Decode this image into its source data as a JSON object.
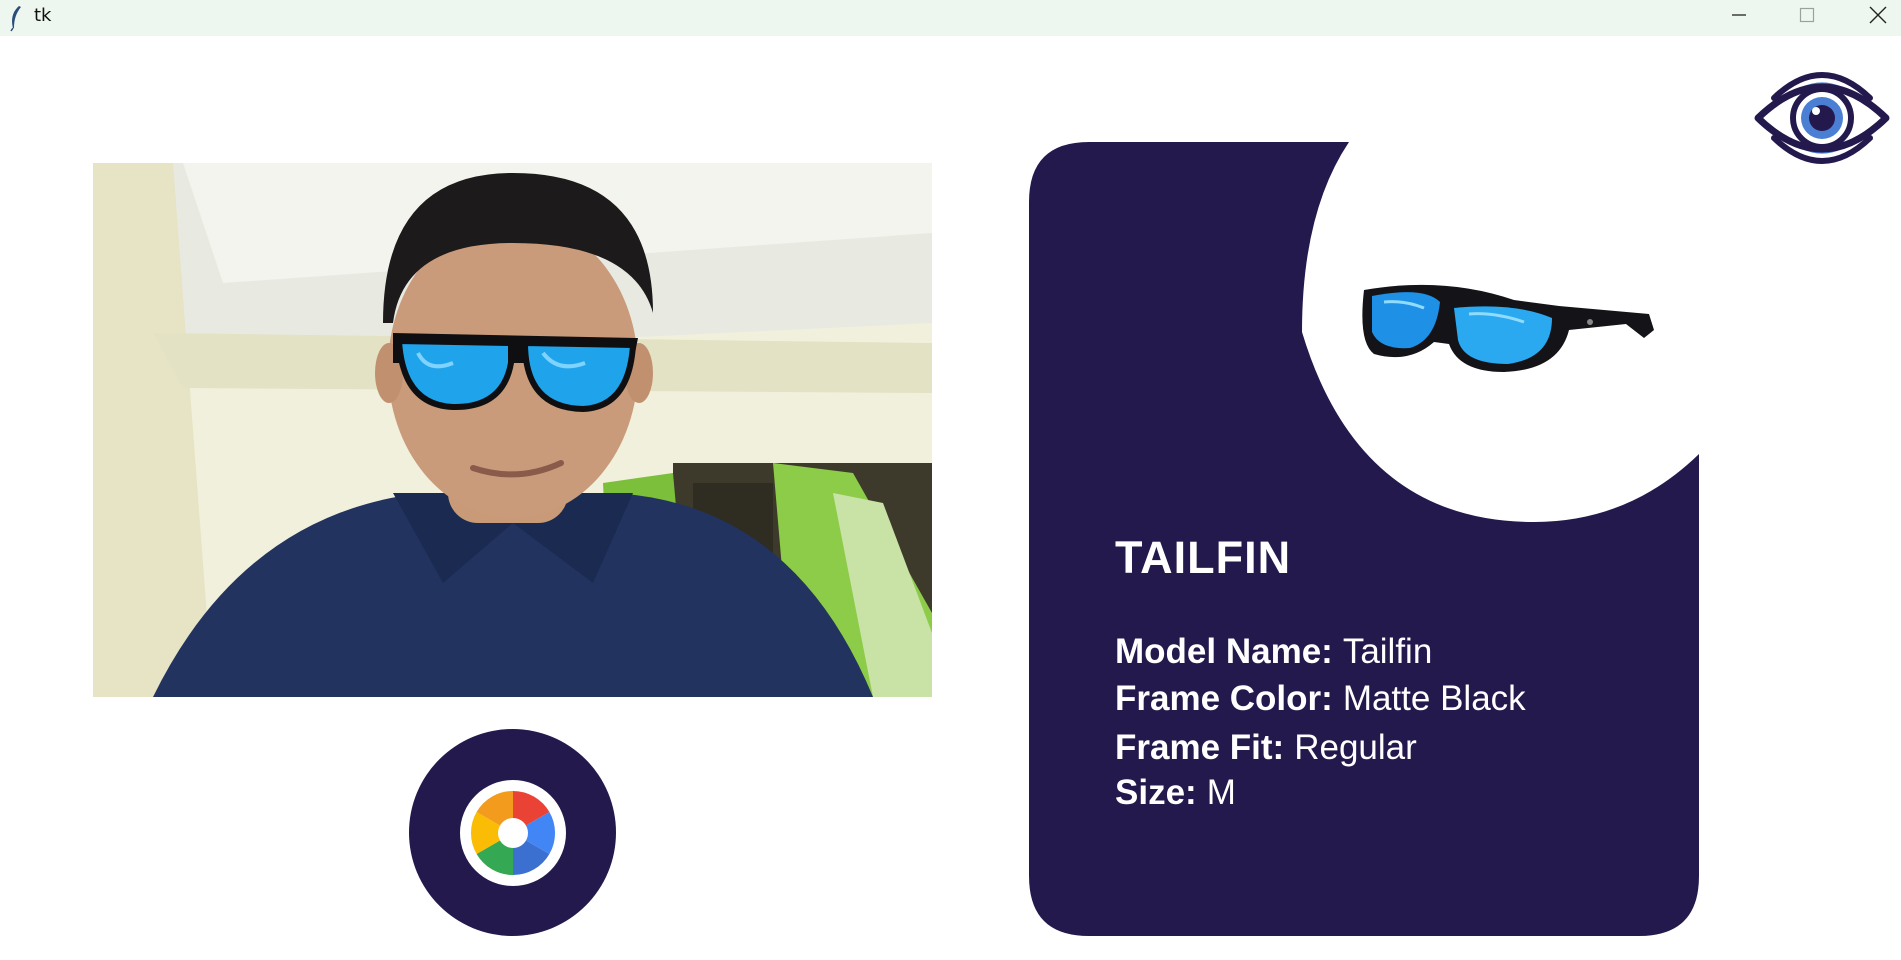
{
  "window": {
    "title": "tk",
    "icons": {
      "app": "feather-icon",
      "minimize": "minimize-icon",
      "maximize": "maximize-icon",
      "close": "close-icon"
    }
  },
  "brand": {
    "icon": "eye-logo-icon"
  },
  "camera": {
    "icon": "camera-shutter-icon"
  },
  "product": {
    "title": "TAILFIN",
    "specs": [
      {
        "label": "Model Name:",
        "value": "Tailfin"
      },
      {
        "label": "Frame Color:",
        "value": "Matte Black"
      },
      {
        "label": "Frame Fit:",
        "value": "Regular"
      },
      {
        "label": "Size:",
        "value": "M"
      }
    ]
  },
  "colors": {
    "navy": "#23194c",
    "titlebar": "#eef7ef",
    "lens_blue": "#1fa3ea",
    "eye_blue": "#4a7fd4"
  }
}
